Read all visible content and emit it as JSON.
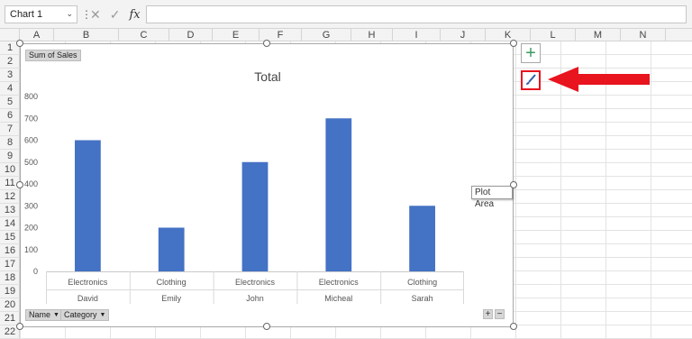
{
  "formula_bar": {
    "name_box": "Chart 1",
    "formula": ""
  },
  "columns": [
    "A",
    "B",
    "C",
    "D",
    "E",
    "F",
    "G",
    "H",
    "I",
    "J",
    "K",
    "L",
    "M",
    "N"
  ],
  "rows": [
    "1",
    "2",
    "3",
    "4",
    "5",
    "6",
    "7",
    "8",
    "9",
    "10",
    "11",
    "12",
    "13",
    "14",
    "15",
    "16",
    "17",
    "18",
    "19",
    "20",
    "21",
    "22"
  ],
  "chart": {
    "field_button_values": "Sum of Sales",
    "field_buttons_axis": [
      {
        "label": "Name"
      },
      {
        "label": "Category"
      }
    ],
    "tooltip": "Plot Area",
    "zoom": {
      "expand": "+",
      "collapse": "−"
    }
  },
  "chart_data": {
    "type": "bar",
    "title": "Total",
    "categories": [
      {
        "inner": "Electronics",
        "outer": "David"
      },
      {
        "inner": "Clothing",
        "outer": "Emily"
      },
      {
        "inner": "Electronics",
        "outer": "John"
      },
      {
        "inner": "Electronics",
        "outer": "Micheal"
      },
      {
        "inner": "Clothing",
        "outer": "Sarah"
      }
    ],
    "series": [
      {
        "name": "Total",
        "values": [
          600,
          200,
          500,
          700,
          300
        ]
      }
    ],
    "ylim": [
      0,
      800
    ],
    "yticks": [
      0,
      100,
      200,
      300,
      400,
      500,
      600,
      700,
      800
    ],
    "legend": "right",
    "grid": false,
    "colors": {
      "bar": "#4472c4",
      "arrow": "#e8141e",
      "plus": "#3c9a5f"
    }
  }
}
